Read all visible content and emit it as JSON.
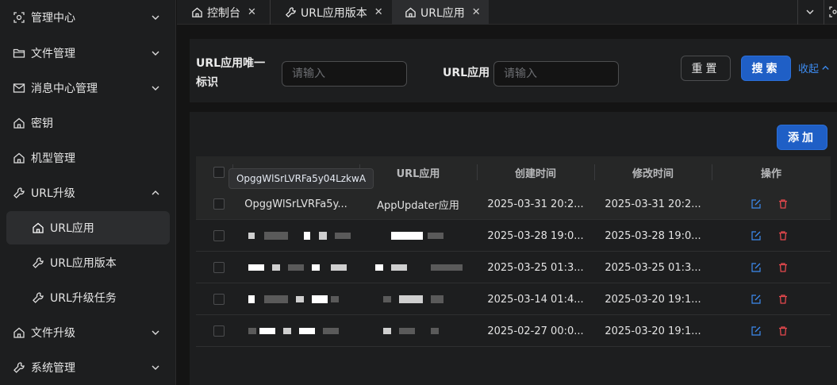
{
  "sidebar": {
    "items": [
      {
        "label": "管理中心",
        "icon": "radar-icon"
      },
      {
        "label": "文件管理",
        "icon": "folder-icon"
      },
      {
        "label": "消息中心管理",
        "icon": "mail-icon"
      },
      {
        "label": "密钥",
        "icon": "home-icon"
      },
      {
        "label": "机型管理",
        "icon": "home-icon"
      },
      {
        "label": "URL升级",
        "icon": "wrench-icon"
      },
      {
        "label": "文件升级",
        "icon": "home-icon"
      },
      {
        "label": "系统管理",
        "icon": "wrench-icon"
      }
    ],
    "sub_items": [
      {
        "label": "URL应用",
        "icon": "home-icon",
        "active": true
      },
      {
        "label": "URL应用版本",
        "icon": "wrench-icon"
      },
      {
        "label": "URL升级任务",
        "icon": "wrench-icon"
      }
    ]
  },
  "tabs": [
    {
      "label": "控制台",
      "icon": "home-icon"
    },
    {
      "label": "URL应用版本",
      "icon": "wrench-icon"
    },
    {
      "label": "URL应用",
      "icon": "home-icon",
      "active": true
    }
  ],
  "search": {
    "field1_label": "URL应用唯一标识",
    "field1_placeholder": "请输入",
    "field2_label": "URL应用",
    "field2_placeholder": "请输入",
    "reset_label": "重置",
    "search_label": "搜索",
    "collapse_label": "收起"
  },
  "table": {
    "add_label": "添加",
    "columns": [
      "URL应用",
      "创建时间",
      "修改时间",
      "操作"
    ],
    "tooltip": "OpggWlSrLVRFa5y04LzkwA",
    "rows": [
      {
        "id": "OpggWlSrLVRFa5y...",
        "app": "AppUpdater应用",
        "created": "2025-03-31 20:2...",
        "modified": "2025-03-31 20:2..."
      },
      {
        "id": "",
        "app": "",
        "created": "2025-03-28 19:0...",
        "modified": "2025-03-28 19:0..."
      },
      {
        "id": "",
        "app": "",
        "created": "2025-03-25 01:3...",
        "modified": "2025-03-25 01:3..."
      },
      {
        "id": "",
        "app": "",
        "created": "2025-03-14 01:4...",
        "modified": "2025-03-20 19:1..."
      },
      {
        "id": "",
        "app": "",
        "created": "2025-02-27 00:0...",
        "modified": "2025-03-20 19:1..."
      }
    ]
  },
  "colors": {
    "accent": "#1f5fc6",
    "link": "#3c8bf0",
    "delete": "#e5484d"
  }
}
